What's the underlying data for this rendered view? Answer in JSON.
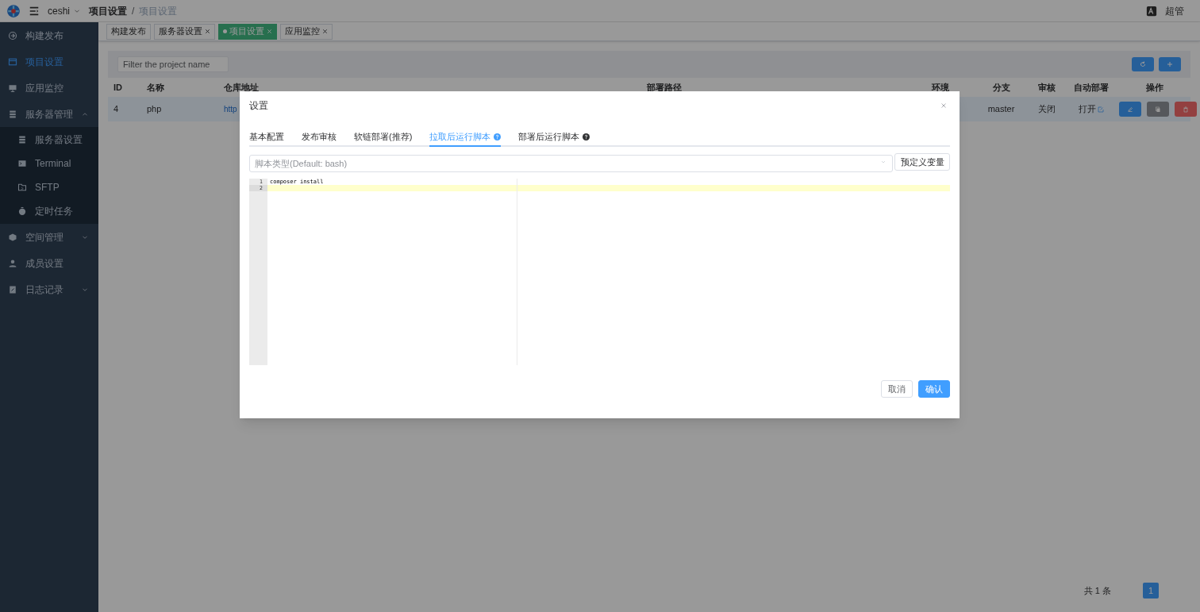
{
  "header": {
    "project": "ceshi",
    "separator": "/",
    "breadcrumb": [
      {
        "label": "项目设置",
        "current": false
      },
      {
        "label": "项目设置",
        "current": true
      }
    ],
    "user": "超管"
  },
  "sidebar": {
    "items": [
      {
        "label": "构建发布",
        "selected": false
      },
      {
        "label": "项目设置",
        "selected": true
      },
      {
        "label": "应用监控",
        "selected": false
      },
      {
        "label": "服务器管理",
        "selected": false,
        "expanded": true,
        "children": [
          {
            "label": "服务器设置",
            "selected": false
          },
          {
            "label": "Terminal",
            "selected": false
          },
          {
            "label": "SFTP",
            "selected": false
          },
          {
            "label": "定时任务",
            "selected": false
          }
        ]
      },
      {
        "label": "空间管理",
        "selected": false,
        "expanded": false
      },
      {
        "label": "成员设置",
        "selected": false
      },
      {
        "label": "日志记录",
        "selected": false,
        "expanded": false
      }
    ]
  },
  "tags": [
    {
      "label": "构建发布",
      "closable": false,
      "selected": false
    },
    {
      "label": "服务器设置",
      "closable": true,
      "selected": false
    },
    {
      "label": "项目设置",
      "closable": true,
      "selected": true
    },
    {
      "label": "应用监控",
      "closable": true,
      "selected": false
    }
  ],
  "filter": {
    "placeholder": "Filter the project name"
  },
  "table": {
    "columns": [
      "ID",
      "名称",
      "仓库地址",
      "部署路径",
      "环境",
      "分支",
      "审核",
      "自动部署",
      "操作"
    ],
    "rows": [
      {
        "id": "4",
        "name": "php",
        "repo": "http",
        "branch": "master",
        "review": "关闭",
        "auto_deploy": "打开"
      }
    ]
  },
  "pagination": {
    "total": "共 1 条",
    "pages": [
      {
        "label": "1",
        "selected": true
      }
    ]
  },
  "dialog": {
    "title": "设置",
    "tabs": [
      {
        "label": "基本配置",
        "help": false,
        "selected": false
      },
      {
        "label": "发布审核",
        "help": false,
        "selected": false
      },
      {
        "label": "软链部署(推荐)",
        "help": false,
        "selected": false
      },
      {
        "label": "拉取后运行脚本",
        "help": true,
        "selected": true
      },
      {
        "label": "部署后运行脚本",
        "help": true,
        "selected": false
      }
    ],
    "script_type": {
      "placeholder": "脚本类型(Default: bash)"
    },
    "variables_button": "预定义变量",
    "editor": {
      "lines": [
        {
          "number": "1",
          "text": "composer install",
          "active": false
        },
        {
          "number": "2",
          "active": true
        }
      ]
    },
    "buttons": [
      {
        "label": "取消",
        "kind": "secondary"
      },
      {
        "label": "确认",
        "kind": "primary"
      }
    ]
  }
}
